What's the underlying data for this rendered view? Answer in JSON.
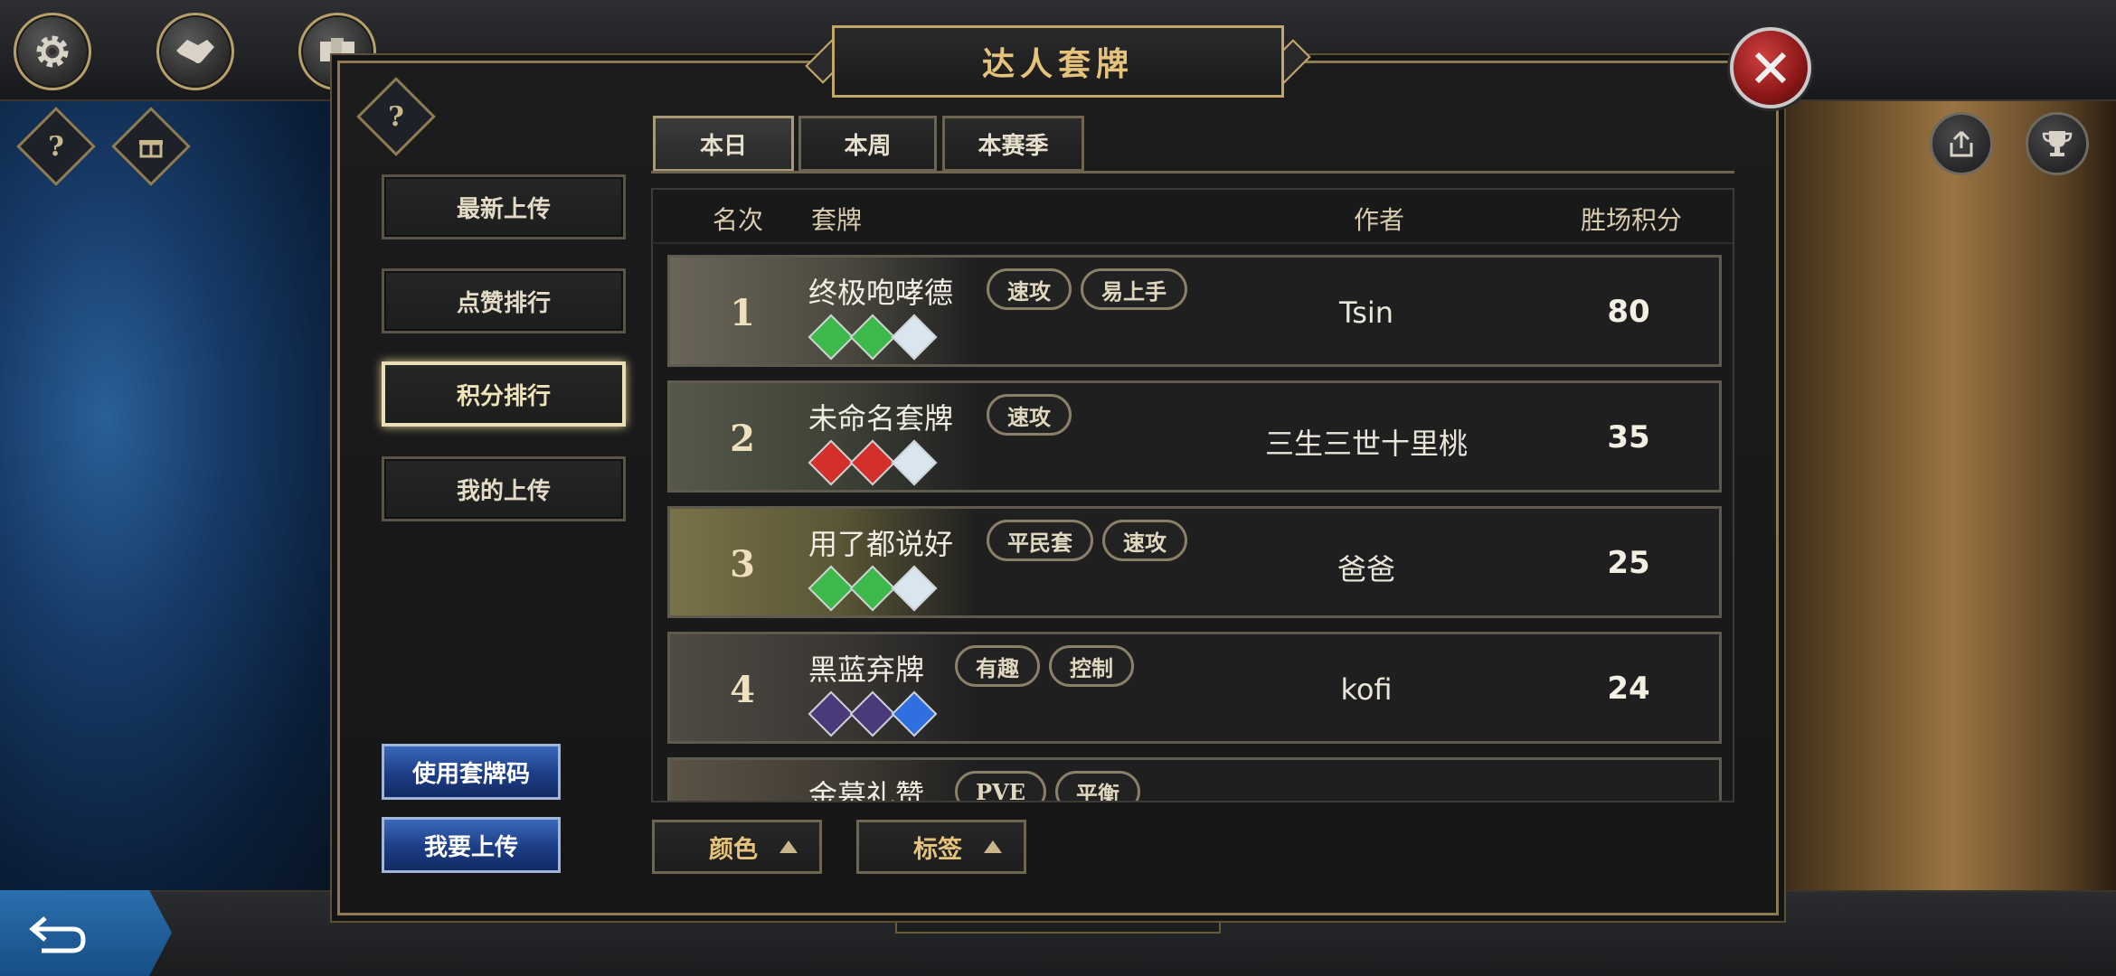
{
  "panel": {
    "title": "达人套牌"
  },
  "side_menu": [
    {
      "label": "最新上传",
      "active": false
    },
    {
      "label": "点赞排行",
      "active": false
    },
    {
      "label": "积分排行",
      "active": true
    },
    {
      "label": "我的上传",
      "active": false
    }
  ],
  "actions": {
    "use_code": "使用套牌码",
    "upload": "我要上传"
  },
  "tabs": [
    {
      "label": "本日",
      "active": true
    },
    {
      "label": "本周",
      "active": false
    },
    {
      "label": "本赛季",
      "active": false
    }
  ],
  "table": {
    "headers": {
      "rank": "名次",
      "deck": "套牌",
      "author": "作者",
      "score": "胜场积分"
    },
    "rows": [
      {
        "rank": "1",
        "name": "终极咆哮德",
        "tags": [
          "速攻",
          "易上手"
        ],
        "gems": [
          "green",
          "green",
          "white"
        ],
        "author": "Tsin",
        "score": "80"
      },
      {
        "rank": "2",
        "name": "未命名套牌",
        "tags": [
          "速攻"
        ],
        "gems": [
          "red",
          "red",
          "white"
        ],
        "author": "三生三世十里桃",
        "score": "35"
      },
      {
        "rank": "3",
        "name": "用了都说好",
        "tags": [
          "平民套",
          "速攻"
        ],
        "gems": [
          "green",
          "green",
          "white"
        ],
        "author": "爸爸",
        "score": "25"
      },
      {
        "rank": "4",
        "name": "黑蓝弃牌",
        "tags": [
          "有趣",
          "控制"
        ],
        "gems": [
          "purple",
          "purple",
          "blue"
        ],
        "author": "kofi",
        "score": "24"
      },
      {
        "rank": "",
        "name": "金墓礼赞",
        "tags": [
          "PVE",
          "平衡"
        ],
        "gems": [],
        "author": "",
        "score": ""
      }
    ]
  },
  "filters": {
    "color": "颜色",
    "tag": "标签"
  },
  "colors": {
    "gold_text": "#e6c37a",
    "gem_green": "#3db84a",
    "gem_red": "#d3302c",
    "gem_white": "#d9e6f0",
    "gem_purple": "#4a3a7a",
    "gem_blue": "#2f6fe0"
  }
}
